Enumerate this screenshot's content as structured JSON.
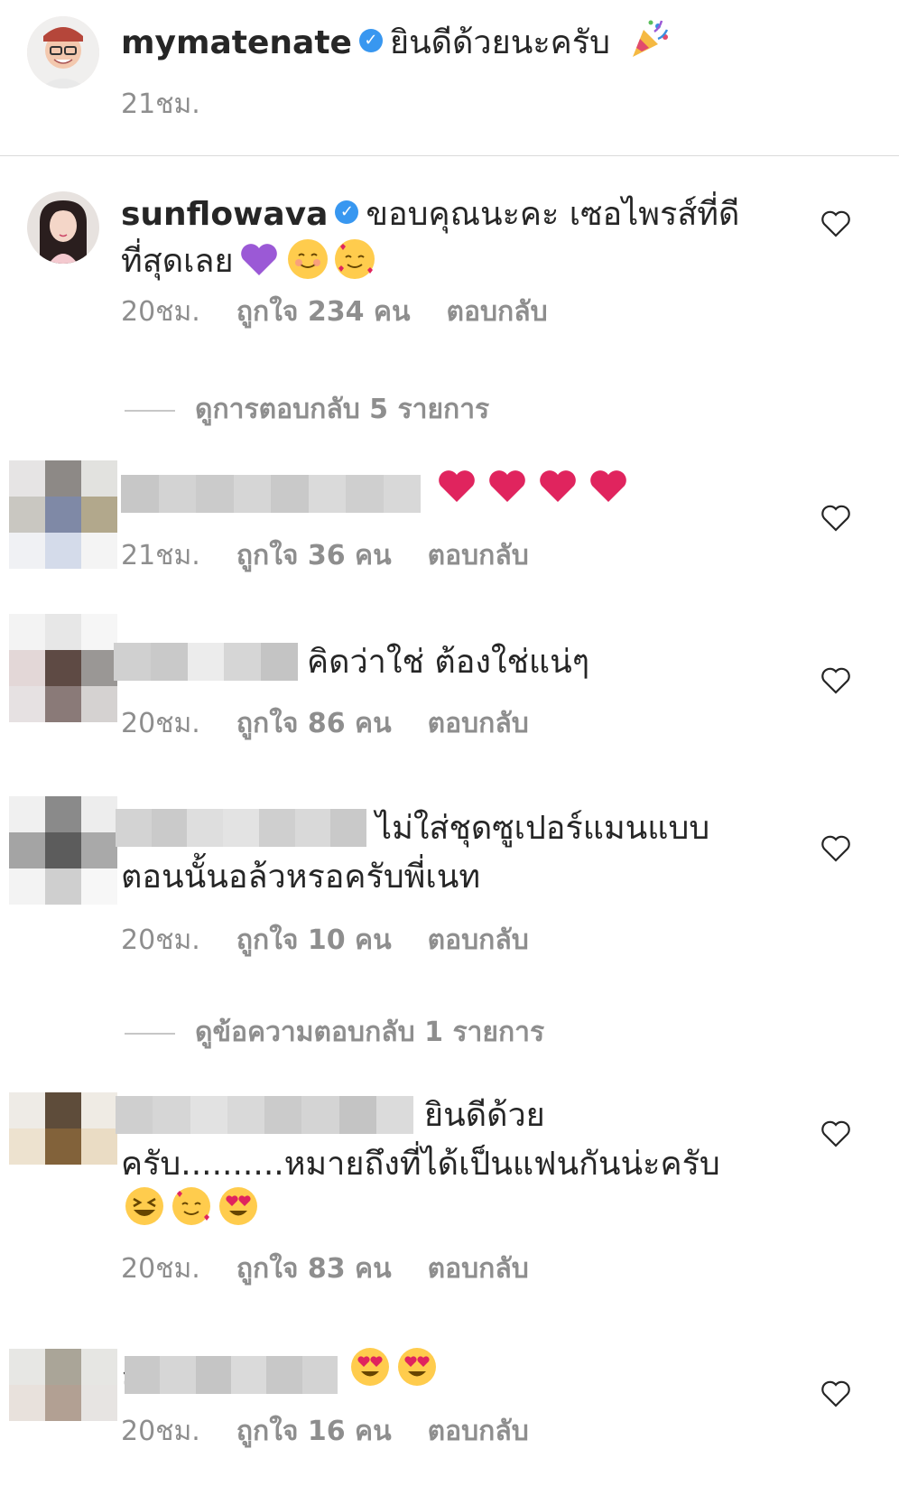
{
  "top_comment": {
    "username": "mymatenate",
    "text": "ยินดีด้วยนะครับ",
    "time": "21ชม.",
    "emoji_icon": "party-popper-icon"
  },
  "comments": [
    {
      "username": "sunflowava",
      "text_line1": "ขอบคุณนะคะ เซอไพรส์ที่ดี",
      "text_line2": "ที่สุดเลย",
      "time": "20ชม.",
      "likes": "ถูกใจ 234 คน",
      "reply": "ตอบกลับ"
    },
    {
      "text": "",
      "time": "21ชม.",
      "likes": "ถูกใจ 36 คน",
      "reply": "ตอบกลับ"
    },
    {
      "text": "คิดว่าใช่ ต้องใช่แน่ๆ",
      "time": "20ชม.",
      "likes": "ถูกใจ 86 คน",
      "reply": "ตอบกลับ"
    },
    {
      "text_line1": "ไม่ใส่ชุดซูเปอร์แมนแบบ",
      "text_line2": "ตอนนั้นอล้วหรอครับพี่เนท",
      "time": "20ชม.",
      "likes": "ถูกใจ 10 คน",
      "reply": "ตอบกลับ"
    },
    {
      "text_line1": "ยินดีด้วย",
      "text_line2": "ครับ..........หมายถึงที่ได้เป็นแฟนกันน่ะครับ",
      "time": "20ชม.",
      "likes": "ถูกใจ 83 คน",
      "reply": "ตอบกลับ"
    },
    {
      "prefix": "ล",
      "time": "20ชม.",
      "likes": "ถูกใจ 16 คน",
      "reply": "ตอบกลับ"
    }
  ],
  "view_replies_1": "ดูการตอบกลับ 5 รายการ",
  "view_replies_2": "ดูข้อความตอบกลับ 1 รายการ",
  "colors": {
    "verified": "#3897f0",
    "meta_gray": "#8e8e8e",
    "heart_red": "#e0245e",
    "purple": "#9b59d6"
  }
}
